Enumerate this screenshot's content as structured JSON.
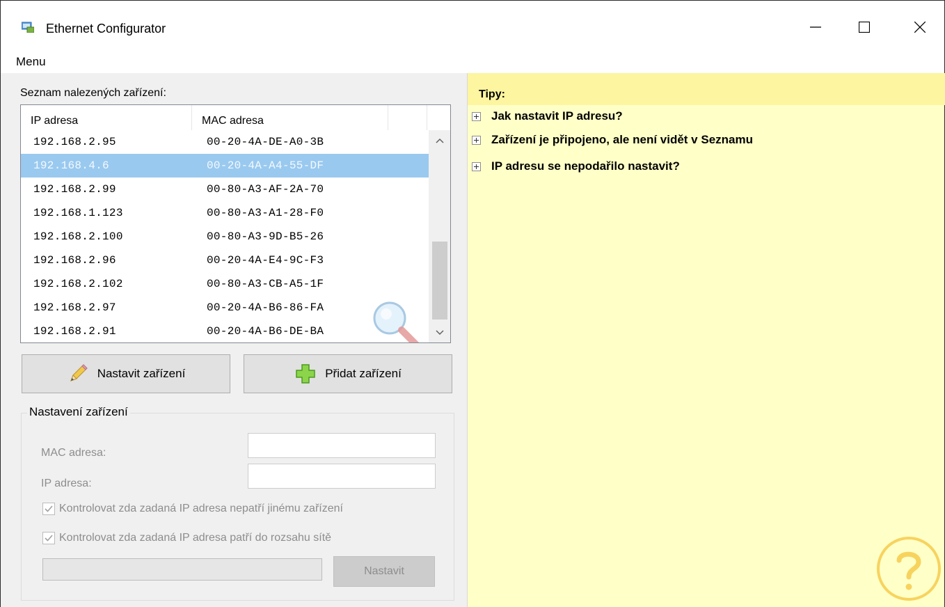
{
  "window": {
    "title": "Ethernet Configurator",
    "icons": {
      "app": "network-window-icon",
      "minimize": "minimize-icon",
      "maximize": "maximize-icon",
      "close": "close-icon"
    }
  },
  "menu": {
    "items": [
      "Menu"
    ]
  },
  "device_list": {
    "caption": "Seznam nalezených zařízení:",
    "columns": [
      "IP adresa",
      "MAC adresa"
    ],
    "rows": [
      {
        "ip": "192.168.2.95",
        "mac": "00-20-4A-DE-A0-3B"
      },
      {
        "ip": "192.168.4.6",
        "mac": "00-20-4A-A4-55-DF"
      },
      {
        "ip": "192.168.2.99",
        "mac": "00-80-A3-AF-2A-70"
      },
      {
        "ip": "192.168.1.123",
        "mac": "00-80-A3-A1-28-F0"
      },
      {
        "ip": "192.168.2.100",
        "mac": "00-80-A3-9D-B5-26"
      },
      {
        "ip": "192.168.2.96",
        "mac": "00-20-4A-E4-9C-F3"
      },
      {
        "ip": "192.168.2.102",
        "mac": "00-80-A3-CB-A5-1F"
      },
      {
        "ip": "192.168.2.97",
        "mac": "00-20-4A-B6-86-FA"
      },
      {
        "ip": "192.168.2.91",
        "mac": "00-20-4A-B6-DE-BA"
      }
    ],
    "selected_index": 1,
    "colors": {
      "selection": "#99c9ef"
    }
  },
  "actions": {
    "configure_label": "Nastavit zařízení",
    "add_label": "Přidat zařízení",
    "configure_icon": "pencil-icon",
    "add_icon": "green-plus-icon"
  },
  "settings": {
    "legend": "Nastavení zařízení",
    "mac_label": "MAC adresa:",
    "ip_label": "IP adresa:",
    "mac_value": "",
    "ip_value": "",
    "check_ip_unused_label": "Kontrolovat zda zadaná IP adresa nepatří jinému zařízení",
    "check_ip_unused_checked": true,
    "check_ip_range_label": "Kontrolovat zda zadaná IP adresa patří do rozsahu sítě",
    "check_ip_range_checked": true,
    "progress": 0,
    "apply_label": "Nastavit",
    "enabled": false
  },
  "tips": {
    "title": "Tipy:",
    "items": [
      "Jak nastavit IP adresu?",
      "Zařízení je připojeno, ale není vidět v Seznamu",
      "IP adresu se nepodařilo nastavit?"
    ],
    "colors": {
      "background": "#ffffc8",
      "header": "#fdf59f"
    },
    "help_icon": "question-mark-icon"
  }
}
